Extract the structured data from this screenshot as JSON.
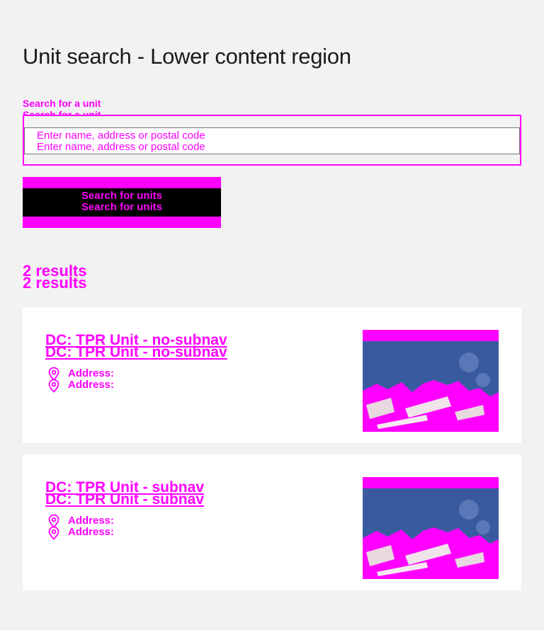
{
  "page": {
    "title": "Unit search - Lower content region"
  },
  "search": {
    "label": "Search for a unit",
    "placeholder": "Enter name, address or postal code",
    "button_label": "Search for units"
  },
  "results": {
    "count_label": "2 results",
    "items": [
      {
        "title": "DC: TPR Unit - no-subnav",
        "address_label": "Address:",
        "image_icon": "building-photo"
      },
      {
        "title": "DC: TPR Unit - subnav",
        "address_label": "Address:",
        "image_icon": "building-photo"
      }
    ]
  },
  "colors": {
    "accent": "#ff00ff",
    "button_band": "#000000",
    "background": "#f2f2f2",
    "card": "#ffffff",
    "image_sky": "#3a5aa0"
  },
  "icons": {
    "address": "location-pin-icon"
  }
}
